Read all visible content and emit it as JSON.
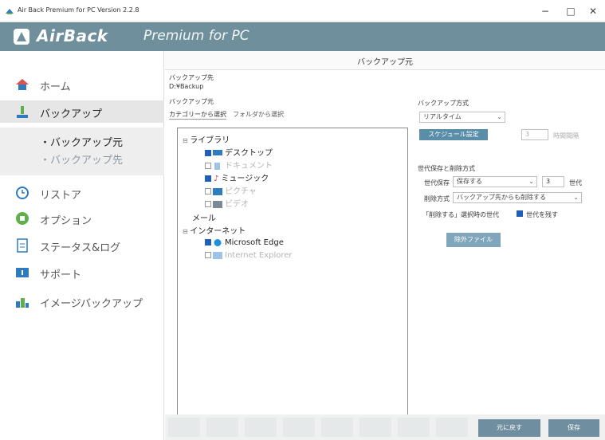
{
  "window": {
    "title": "Air Back Premium for PC Version 2.2.8",
    "minimize": "−",
    "maximize": "□",
    "close": "✕"
  },
  "banner": {
    "brand": "AirBack",
    "product": "Premium for PC"
  },
  "sidebar": {
    "items": [
      {
        "label": "ホーム",
        "icon": "home-icon"
      },
      {
        "label": "バックアップ",
        "icon": "backup-icon"
      },
      {
        "label": "リストア",
        "icon": "restore-icon"
      },
      {
        "label": "オプション",
        "icon": "option-icon"
      },
      {
        "label": "ステータス&ログ",
        "icon": "status-log-icon"
      },
      {
        "label": "サポート",
        "icon": "support-icon"
      },
      {
        "label": "イメージバックアップ",
        "icon": "image-backup-icon"
      }
    ],
    "sub_items": [
      "・バックアップ元",
      "・バックアップ先"
    ]
  },
  "content": {
    "header": "バックアップ元",
    "dest_label": "バックアップ先",
    "dest_value": "D:¥Backup",
    "source_label": "バックアップ元",
    "tab_category": "カテゴリーから選択",
    "tab_folder": "フォルダから選択"
  },
  "tree": {
    "library": "ライブラリ",
    "desktop": "デスクトップ",
    "documents": "ドキュメント",
    "music": "ミュージック",
    "pictures": "ピクチャ",
    "videos": "ビデオ",
    "mail": "メール",
    "internet": "インターネット",
    "edge": "Microsoft Edge",
    "ie": "Internet Explorer"
  },
  "method": {
    "label": "バックアップ方式",
    "mode": "リアルタイム",
    "schedule_button": "スケジュール設定",
    "interval_value": "3",
    "interval_unit": "時間間隔"
  },
  "generation": {
    "label": "世代保存と削除方式",
    "save_label": "世代保存",
    "save_value": "保存する",
    "count": "3",
    "count_unit": "世代",
    "delete_label": "削除方式",
    "delete_value": "バックアップ先からも削除する",
    "delete_note": "「削除する」選択時の世代",
    "keep_label": "世代を残す"
  },
  "exclude_button": "除外ファイル",
  "footer": {
    "reset": "元に戻す",
    "save": "保存"
  },
  "colors": {
    "banner": "#6f8f9c",
    "accent": "#5a8ea8",
    "checkbox": "#1f5fb8"
  }
}
